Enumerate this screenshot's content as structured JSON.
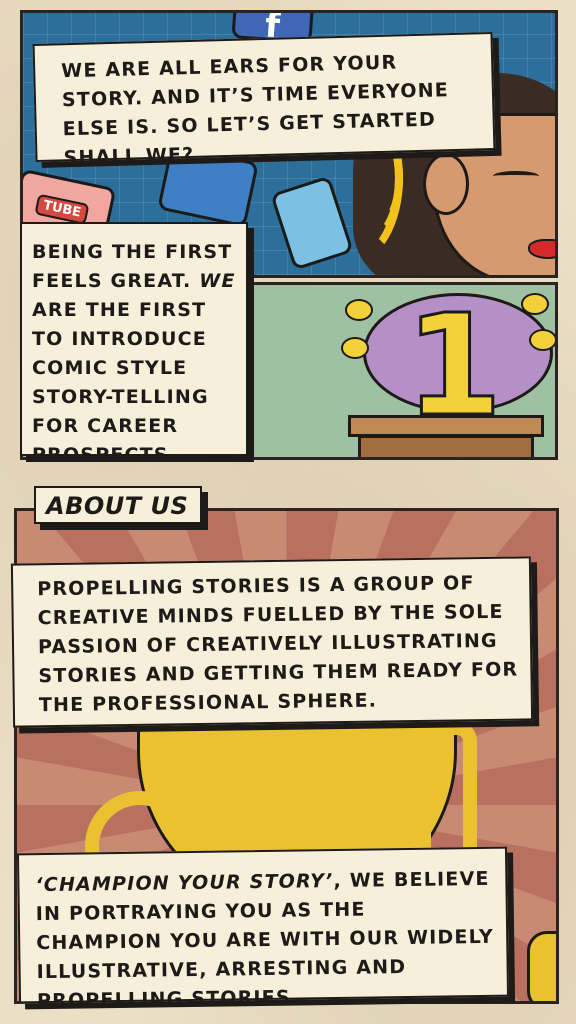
{
  "panels": {
    "top": {
      "caption": "We are all ears for your story. And it’s time everyone else is. So let’s get started shall we?",
      "tiles": {
        "facebook": "f",
        "youtube": "TUBE"
      }
    },
    "middle": {
      "caption_before": "Being the first feels great. ",
      "caption_bold": "We",
      "caption_after": " are the first to introduce comic style story-telling for career prospects.",
      "big_number": "1"
    }
  },
  "about": {
    "heading": "About Us",
    "description": "Propelling Stories is a group of creative minds fuelled by the sole passion of creatively illustrating stories and getting them ready for the professional sphere.",
    "champion_bold": "‘Champion your story’",
    "champion_text": ", we believe in portraying you as the champion you are with our widely illustrative, arresting and propelling stories."
  },
  "colors": {
    "panel_top_bg": "#2b6f9a",
    "panel_mid_bg": "#9fc0a3",
    "panel_bottom_ray_a": "#b9705e",
    "panel_bottom_ray_b": "#c98a73",
    "caption_bg": "#f6efd9",
    "accent_yellow": "#f2c21b"
  }
}
